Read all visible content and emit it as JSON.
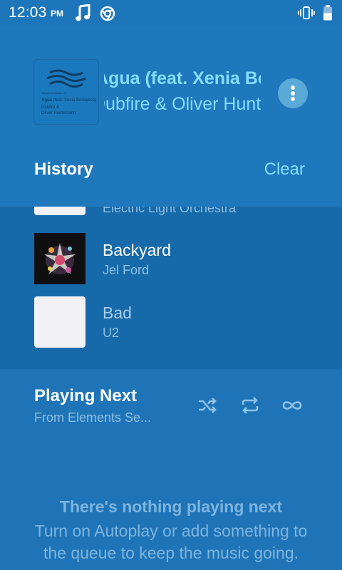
{
  "status_bar": {
    "time": "12:03",
    "ampm": "PM",
    "icons": [
      "music-note-icon",
      "chrome-icon",
      "vibrate-icon",
      "battery-icon"
    ]
  },
  "now_playing": {
    "artwork_text": {
      "series": "Elements Series Vi",
      "song": "Agua",
      "feat": "(feat. Xenia Beliayeva)",
      "artists_line1": "Dubfire &",
      "artists_line2": "Oliver Huntemann"
    },
    "title_scroll": "Agua (feat. Xenia Beliayeva)",
    "artist_scroll": "Dubfire & Oliver Huntemann",
    "more_icon": "more-vertical-icon"
  },
  "history": {
    "title": "History",
    "clear_label": "Clear",
    "items": [
      {
        "title": "",
        "artist": "Electric Light Orchestra"
      },
      {
        "title": "Backyard",
        "artist": "Jel Ford"
      },
      {
        "title": "Bad",
        "artist": "U2"
      }
    ]
  },
  "playing_next": {
    "title": "Playing Next",
    "subtitle": "From Elements Se...",
    "controls": [
      "shuffle-icon",
      "repeat-icon",
      "infinity-icon"
    ]
  },
  "empty_state": {
    "title": "There's nothing playing next",
    "body": "Turn on Autoplay or add something to the queue to keep the music going."
  },
  "colors": {
    "background": "#1f74b8",
    "accent": "#84ddff",
    "history_bg": "#176aa9"
  }
}
